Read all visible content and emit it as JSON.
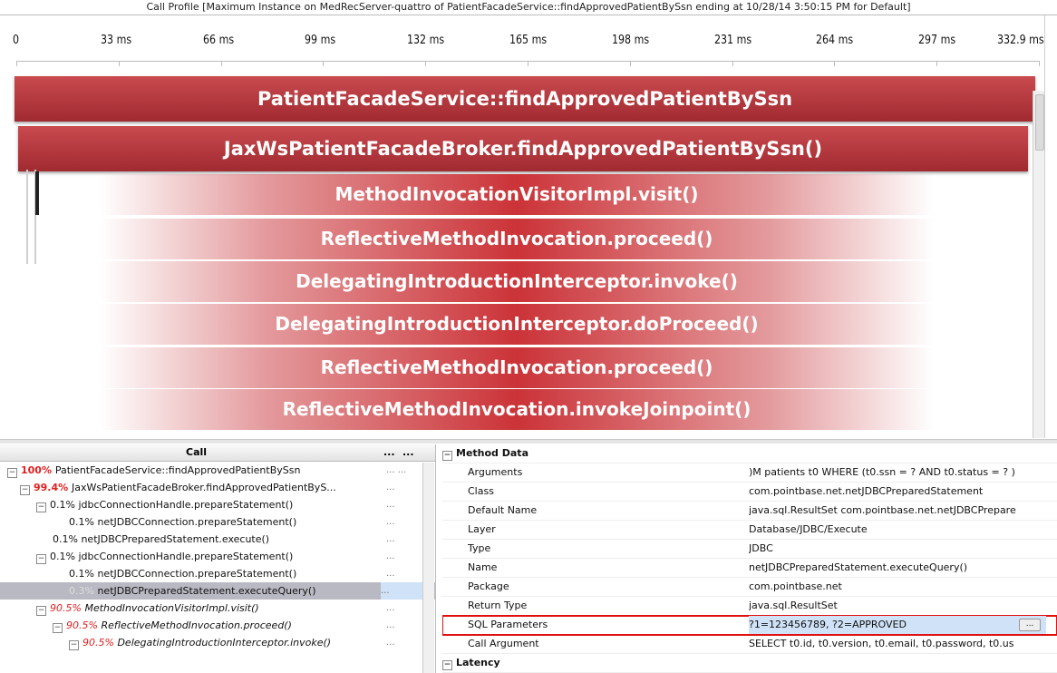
{
  "window": {
    "title": "Call Profile [Maximum Instance on MedRecServer-quattro of PatientFacadeService::findApprovedPatientBySsn ending at 10/28/14 3:50:15 PM for Default]"
  },
  "timeline": {
    "ticks": [
      "0",
      "33 ms",
      "66 ms",
      "99 ms",
      "132 ms",
      "165 ms",
      "198 ms",
      "231 ms",
      "264 ms",
      "297 ms",
      "332.9 ms"
    ]
  },
  "flame": {
    "bars": [
      "PatientFacadeService::findApprovedPatientBySsn",
      "JaxWsPatientFacadeBroker.findApprovedPatientBySsn()",
      "MethodInvocationVisitorImpl.visit()",
      "ReflectiveMethodInvocation.proceed()",
      "DelegatingIntroductionInterceptor.invoke()",
      "DelegatingIntroductionInterceptor.doProceed()",
      "ReflectiveMethodInvocation.proceed()",
      "ReflectiveMethodInvocation.invokeJoinpoint()"
    ],
    "colors": {
      "primary": "#c94a4f",
      "dark": "#a02a30"
    }
  },
  "call_tree": {
    "header": "Call",
    "col2": "...",
    "col3": "...",
    "rows": [
      {
        "pct": "100%",
        "label": "PatientFacadeService::findApprovedPatientBySsn",
        "dots": "... ..."
      },
      {
        "pct": "99.4%",
        "label": "JaxWsPatientFacadeBroker.findApprovedPatientByS...",
        "dots": "..."
      },
      {
        "pct": "0.1%",
        "label": "jdbcConnectionHandle.prepareStatement()",
        "dots": "..."
      },
      {
        "pct": "0.1%",
        "label": "netJDBCConnection.prepareStatement()",
        "dots": "..."
      },
      {
        "pct": "0.1%",
        "label": "netJDBCPreparedStatement.execute()",
        "dots": "..."
      },
      {
        "pct": "0.1%",
        "label": "jdbcConnectionHandle.prepareStatement()",
        "dots": "..."
      },
      {
        "pct": "0.1%",
        "label": "netJDBCConnection.prepareStatement()",
        "dots": "..."
      },
      {
        "pct": "0.3%",
        "label": "netJDBCPreparedStatement.executeQuery()",
        "dots": "..."
      },
      {
        "pct": "90.5%",
        "label": "MethodInvocationVisitorImpl.visit()",
        "dots": "..."
      },
      {
        "pct": "90.5%",
        "label": "ReflectiveMethodInvocation.proceed()",
        "dots": "..."
      },
      {
        "pct": "90.5%",
        "label": "DelegatingIntroductionInterceptor.invoke()",
        "dots": "..."
      }
    ]
  },
  "properties": {
    "section1": "Method Data",
    "section2": "Latency",
    "rows": [
      {
        "key": "Arguments",
        "value": ")M patients t0 WHERE (t0.ssn = ? AND t0.status = ? )"
      },
      {
        "key": "Class",
        "value": "com.pointbase.net.netJDBCPreparedStatement"
      },
      {
        "key": "Default Name",
        "value": "java.sql.ResultSet com.pointbase.net.netJDBCPrepare"
      },
      {
        "key": "Layer",
        "value": "Database/JDBC/Execute"
      },
      {
        "key": "Type",
        "value": "JDBC"
      },
      {
        "key": "Name",
        "value": "netJDBCPreparedStatement.executeQuery()"
      },
      {
        "key": "Package",
        "value": "com.pointbase.net"
      },
      {
        "key": "Return Type",
        "value": "java.sql.ResultSet"
      },
      {
        "key": "SQL Parameters",
        "value": "?1=123456789, ?2=APPROVED"
      },
      {
        "key": "Call Argument",
        "value": "SELECT t0.id, t0.version, t0.email, t0.password, t0.us"
      }
    ],
    "edit_button": "...",
    "highlight_color": "#e01010"
  }
}
